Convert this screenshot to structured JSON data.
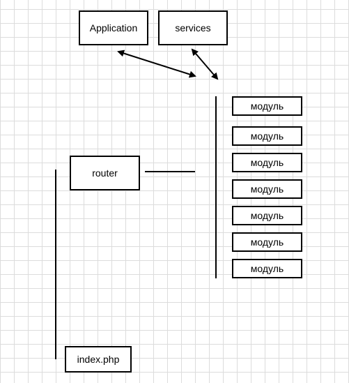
{
  "nodes": {
    "application": "Application",
    "services": "services",
    "router": "router",
    "index": "index.php",
    "modules": [
      "модуль",
      "модуль",
      "модуль",
      "модуль",
      "модуль",
      "модуль",
      "модуль"
    ]
  },
  "colors": {
    "stroke": "#000000",
    "grid": "#dcdcdc"
  }
}
